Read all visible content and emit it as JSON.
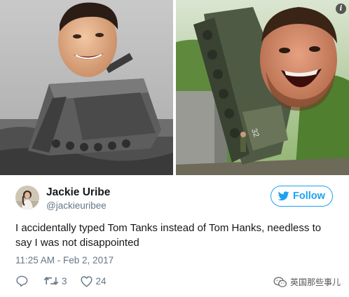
{
  "tweet": {
    "author_name": "Jackie Uribe",
    "author_handle": "@jackieuribee",
    "text": "I accidentally typed Tom Tanks instead of Tom Hanks, needless to say I was not disappointed",
    "timestamp": "11:25 AM - Feb 2, 2017",
    "follow_label": "Follow",
    "retweets": "3",
    "likes": "24"
  },
  "watermark": {
    "text": "英国那些事儿"
  },
  "media": {
    "left_image": "tank-with-head-photo-grayscale",
    "right_image": "tank-with-screaming-head-photo",
    "tank_number": "32"
  },
  "colors": {
    "accent": "#1da1f2",
    "secondary_text": "#657786",
    "primary_text": "#14171a"
  },
  "icons": [
    "info-icon",
    "twitter-bird-icon",
    "reply-icon",
    "retweet-icon",
    "like-icon",
    "wechat-icon"
  ]
}
